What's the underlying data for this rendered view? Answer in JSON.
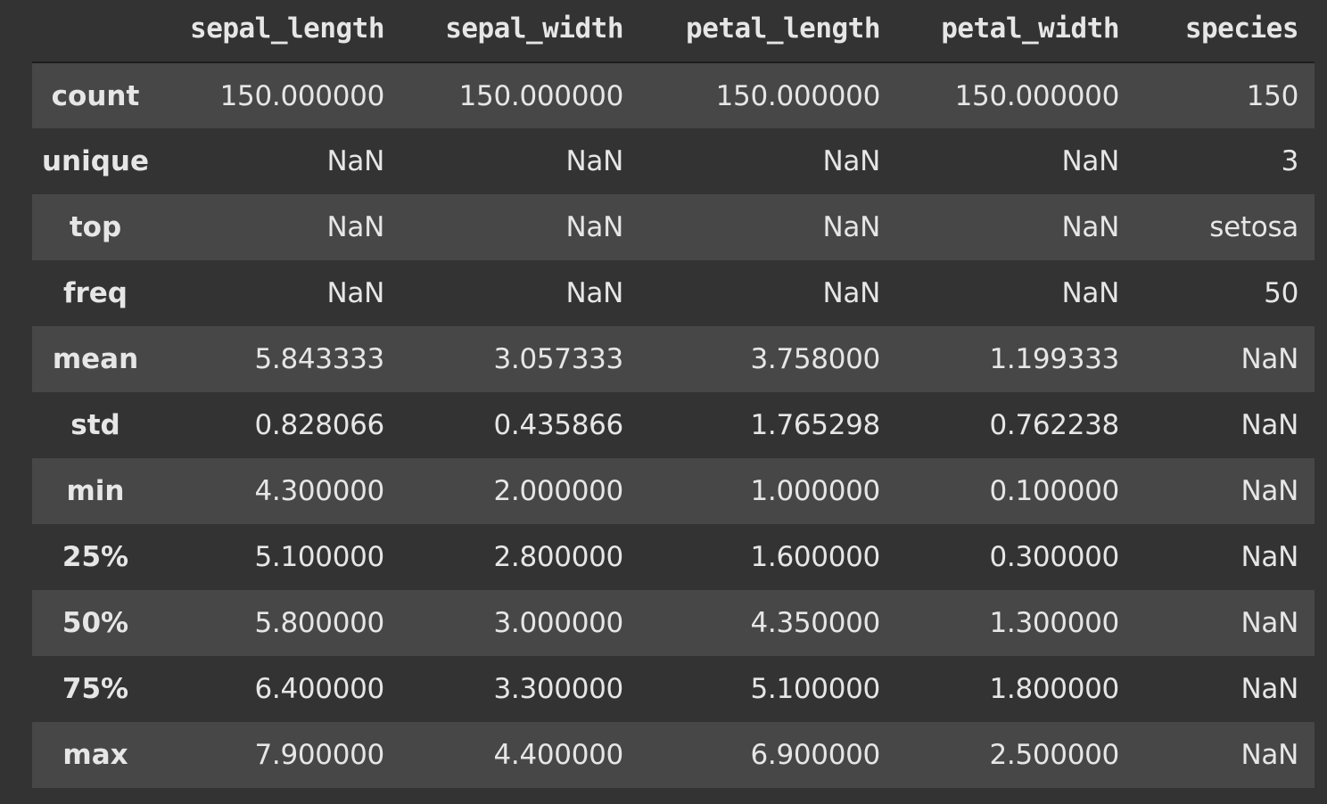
{
  "table": {
    "columns": [
      "sepal_length",
      "sepal_width",
      "petal_length",
      "petal_width",
      "species"
    ],
    "rows": [
      {
        "index": "count",
        "values": [
          "150.000000",
          "150.000000",
          "150.000000",
          "150.000000",
          "150"
        ]
      },
      {
        "index": "unique",
        "values": [
          "NaN",
          "NaN",
          "NaN",
          "NaN",
          "3"
        ]
      },
      {
        "index": "top",
        "values": [
          "NaN",
          "NaN",
          "NaN",
          "NaN",
          "setosa"
        ]
      },
      {
        "index": "freq",
        "values": [
          "NaN",
          "NaN",
          "NaN",
          "NaN",
          "50"
        ]
      },
      {
        "index": "mean",
        "values": [
          "5.843333",
          "3.057333",
          "3.758000",
          "1.199333",
          "NaN"
        ]
      },
      {
        "index": "std",
        "values": [
          "0.828066",
          "0.435866",
          "1.765298",
          "0.762238",
          "NaN"
        ]
      },
      {
        "index": "min",
        "values": [
          "4.300000",
          "2.000000",
          "1.000000",
          "0.100000",
          "NaN"
        ]
      },
      {
        "index": "25%",
        "values": [
          "5.100000",
          "2.800000",
          "1.600000",
          "0.300000",
          "NaN"
        ]
      },
      {
        "index": "50%",
        "values": [
          "5.800000",
          "3.000000",
          "4.350000",
          "1.300000",
          "NaN"
        ]
      },
      {
        "index": "75%",
        "values": [
          "6.400000",
          "3.300000",
          "5.100000",
          "1.800000",
          "NaN"
        ]
      },
      {
        "index": "max",
        "values": [
          "7.900000",
          "4.400000",
          "6.900000",
          "2.500000",
          "NaN"
        ]
      }
    ]
  },
  "colors": {
    "background": "#333333",
    "row_stripe": "#474747",
    "text": "#e6e6e6",
    "header_rule": "#1e1e1e"
  }
}
